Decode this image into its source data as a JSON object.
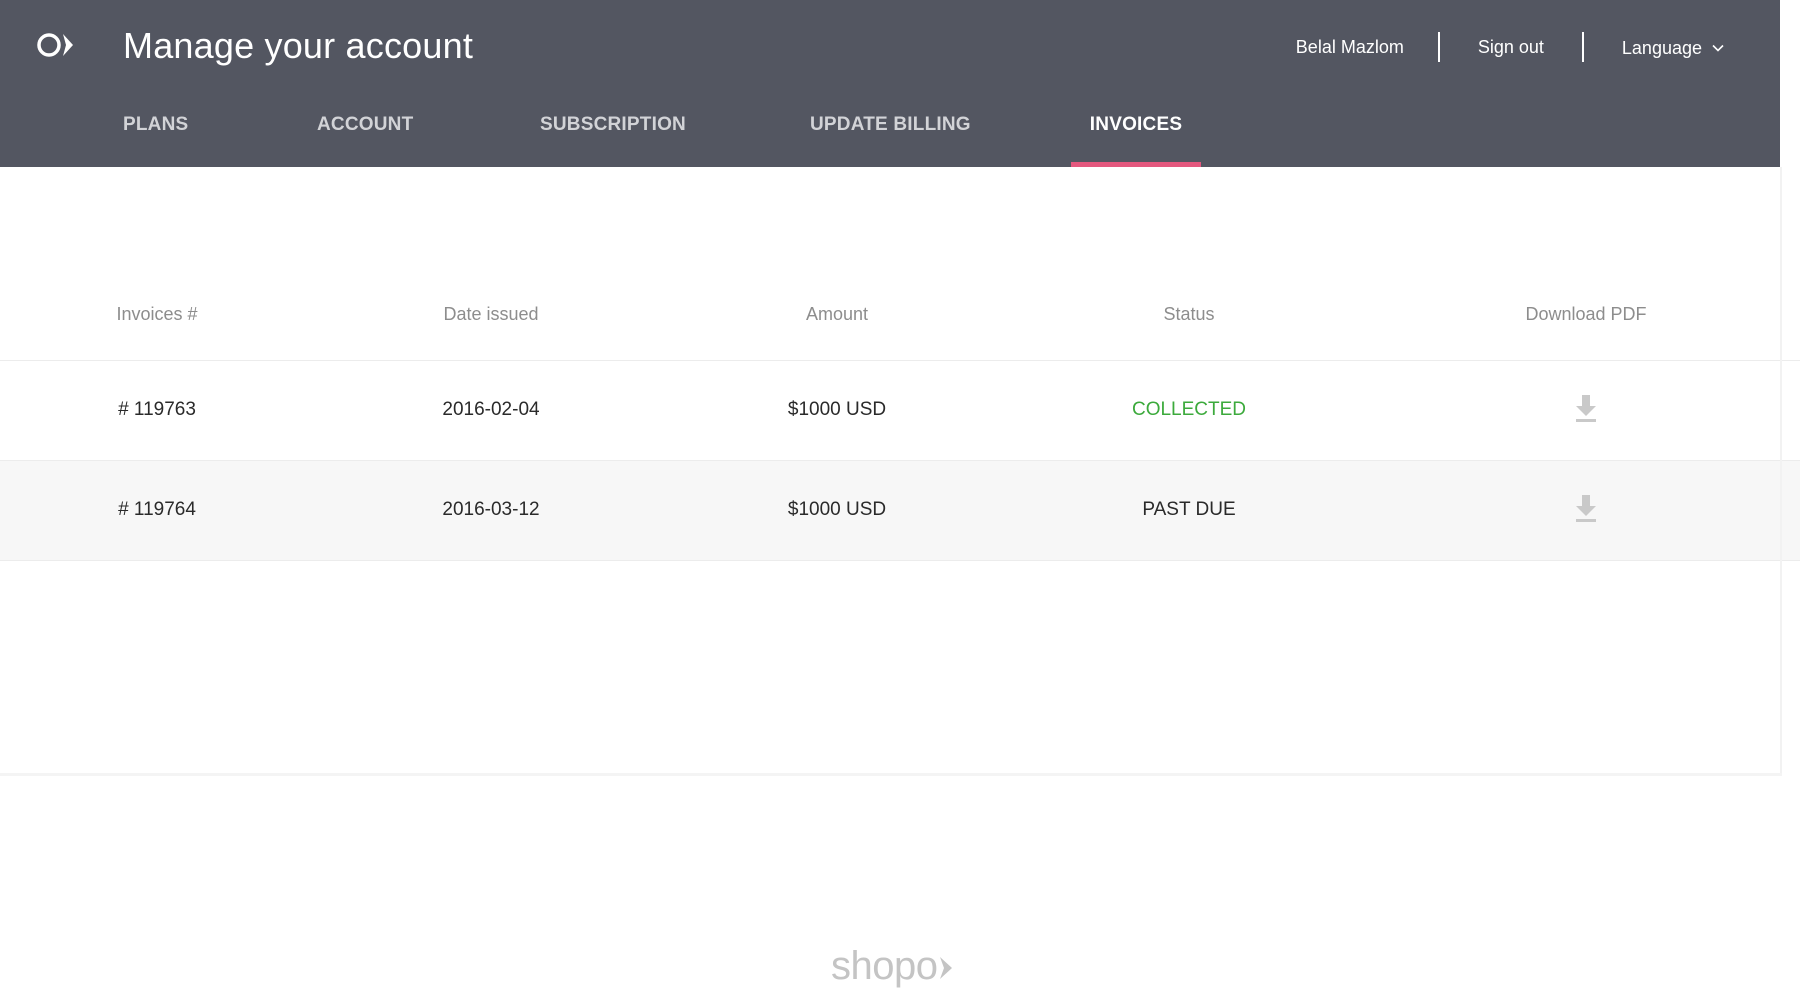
{
  "header": {
    "title": "Manage your account",
    "user_name": "Belal Mazlom",
    "sign_out": "Sign out",
    "language": "Language"
  },
  "tabs": [
    {
      "label": "PLANS",
      "active": false
    },
    {
      "label": "ACCOUNT",
      "active": false
    },
    {
      "label": "SUBSCRIPTION",
      "active": false
    },
    {
      "label": "UPDATE BILLING",
      "active": false
    },
    {
      "label": "INVOICES",
      "active": true
    }
  ],
  "table": {
    "columns": [
      "Invoices #",
      "Date issued",
      "Amount",
      "Status",
      "Download PDF"
    ],
    "rows": [
      {
        "invoice": "# 119763",
        "date": "2016-02-04",
        "amount": "$1000 USD",
        "status": "COLLECTED"
      },
      {
        "invoice": "# 119764",
        "date": "2016-03-12",
        "amount": "$1000 USD",
        "status": "PAST DUE"
      }
    ]
  },
  "footer": {
    "brand": "shopo"
  },
  "colors": {
    "header_bg": "#535661",
    "accent": "#e4587e",
    "status_collected": "#3caa3c"
  }
}
